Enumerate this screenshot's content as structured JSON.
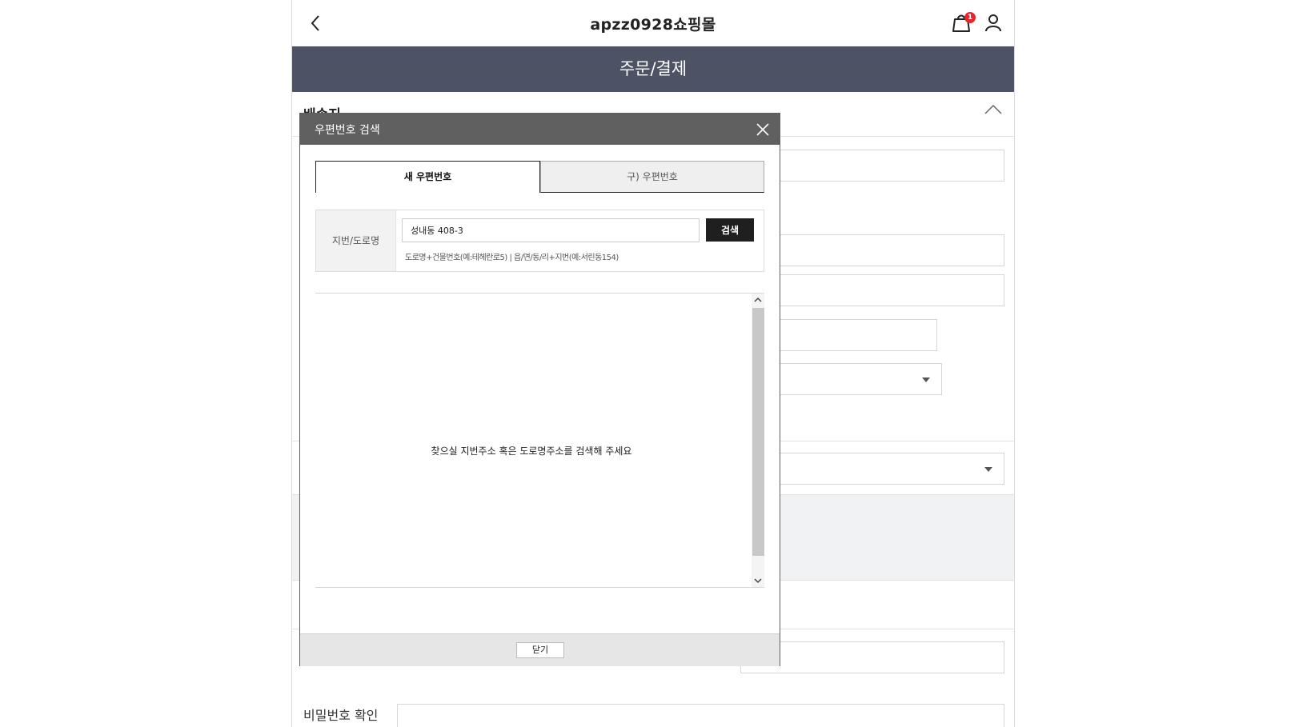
{
  "header": {
    "site_title": "apzz0928쇼핑몰",
    "cart_count": "1",
    "page_title": "주문/결제"
  },
  "section": {
    "title": "배송지"
  },
  "form": {
    "password_confirm_label": "비밀번호 확인"
  },
  "modal": {
    "title": "우편번호 검색",
    "tabs": [
      {
        "label": "새 우편번호",
        "active": true
      },
      {
        "label": "구) 우편번호",
        "active": false
      }
    ],
    "search": {
      "label": "지번/도로명",
      "value": "성내동 408-3",
      "button_label": "검색",
      "hint": "도로명+건물번호(예:테헤란로5) | 읍/면/동/리+지번(예:서린동154)"
    },
    "results": {
      "empty_message": "찾으실 지번주소 혹은 도로명주소를 검색해 주세요"
    },
    "footer": {
      "close_label": "닫기"
    }
  },
  "colors": {
    "title_band": "#4d5264",
    "modal_header": "#606060",
    "badge": "#e8242c",
    "search_button": "#1f1f1f"
  }
}
